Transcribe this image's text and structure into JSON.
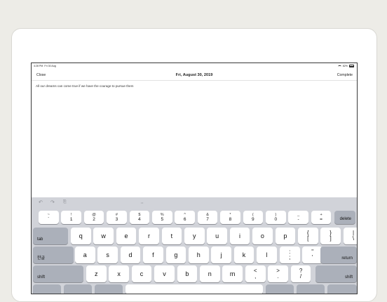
{
  "status": {
    "time": "4:28 PM",
    "date": "Fri 30 Aug",
    "battery": "82%"
  },
  "nav": {
    "close": "Close",
    "title": "Fri, August 30, 2019",
    "complete": "Complete"
  },
  "note": {
    "text": "All our dreams can come true if we have the courage to pursue them"
  },
  "toolbar": {
    "handle": "••"
  },
  "numrow": [
    {
      "top": "~",
      "bot": "`"
    },
    {
      "top": "!",
      "bot": "1"
    },
    {
      "top": "@",
      "bot": "2"
    },
    {
      "top": "#",
      "bot": "3"
    },
    {
      "top": "$",
      "bot": "4"
    },
    {
      "top": "%",
      "bot": "5"
    },
    {
      "top": "^",
      "bot": "6"
    },
    {
      "top": "&",
      "bot": "7"
    },
    {
      "top": "*",
      "bot": "8"
    },
    {
      "top": "(",
      "bot": "9"
    },
    {
      "top": ")",
      "bot": "0"
    },
    {
      "top": "_",
      "bot": "-"
    },
    {
      "top": "+",
      "bot": "="
    }
  ],
  "keys": {
    "delete": "delete",
    "tab": "tab",
    "korean": "한글",
    "return": "return",
    "shift": "shift",
    "row_q": [
      "q",
      "w",
      "e",
      "r",
      "t",
      "y",
      "u",
      "i",
      "o",
      "p"
    ],
    "row_q_sym": [
      {
        "top": "{",
        "bot": "["
      },
      {
        "top": "}",
        "bot": "]"
      },
      {
        "top": "|",
        "bot": "\\"
      }
    ],
    "row_a": [
      "a",
      "s",
      "d",
      "f",
      "g",
      "h",
      "j",
      "k",
      "l"
    ],
    "row_a_sym": [
      {
        "top": ":",
        "bot": ";"
      },
      {
        "top": "\"",
        "bot": "'"
      }
    ],
    "row_z": [
      "z",
      "x",
      "c",
      "v",
      "b",
      "n",
      "m"
    ],
    "row_z_sym": [
      {
        "top": "<",
        "bot": ","
      },
      {
        "top": ">",
        "bot": "."
      },
      {
        "top": "?",
        "bot": "/"
      }
    ]
  }
}
